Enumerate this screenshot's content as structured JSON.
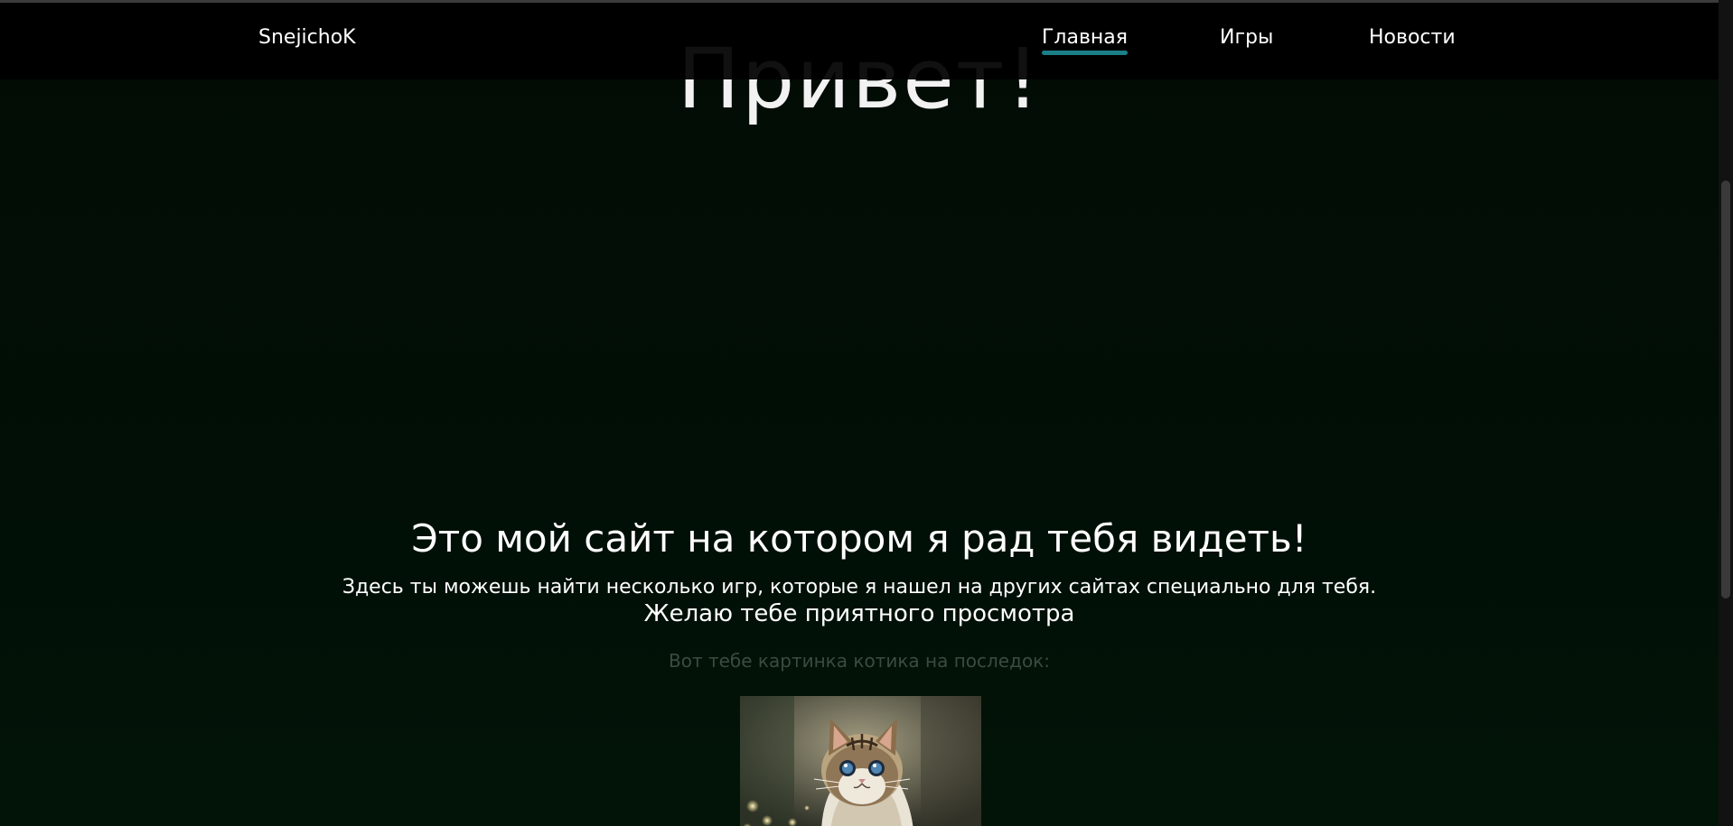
{
  "header": {
    "brand": "SnejichoK",
    "nav": [
      {
        "label": "Главная",
        "active": true
      },
      {
        "label": "Игры",
        "active": false
      },
      {
        "label": "Новости",
        "active": false
      }
    ]
  },
  "hero": {
    "title": "Привет!"
  },
  "main": {
    "heading": "Это мой сайт на котором я рад тебя видеть!",
    "subtext": "Здесь ты можешь найти несколько игр, которые я нашел на других сайтах специально для тебя.",
    "wish": "Желаю тебе приятного просмотра",
    "caption": "Вот тебе картинка котика на последок:"
  },
  "colors": {
    "background": "#020e06",
    "accent": "#1a7f86",
    "navbar": "#000000",
    "muted_text": "#3d4a42"
  },
  "icons": {
    "kitten_image": "kitten-photo"
  }
}
